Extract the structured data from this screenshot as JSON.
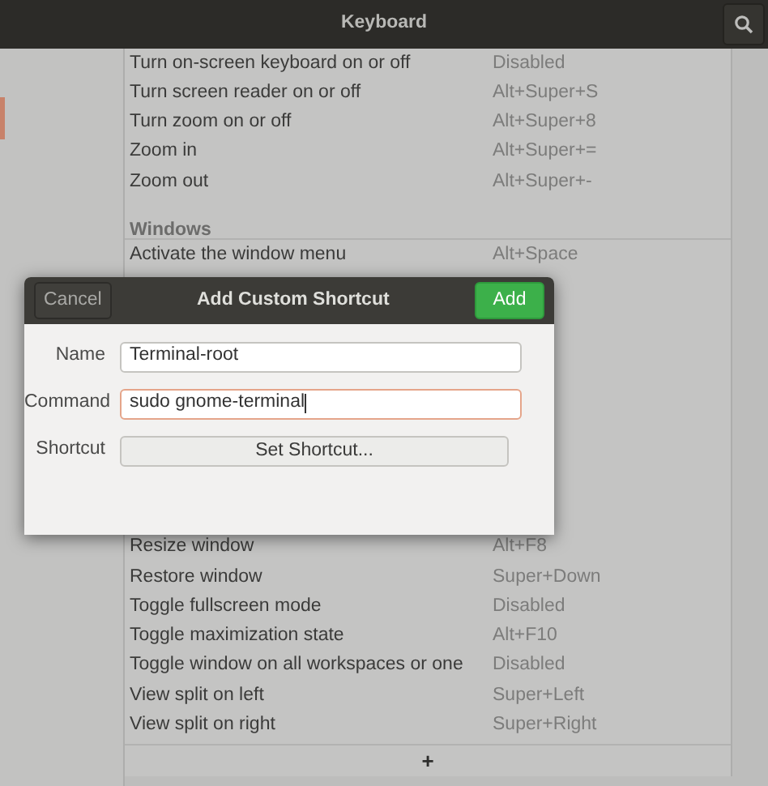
{
  "window": {
    "title": "Keyboard"
  },
  "sections": [
    {
      "rows": [
        {
          "name": "Turn on-screen keyboard on or off",
          "shortcut": "Disabled"
        },
        {
          "name": "Turn screen reader on or off",
          "shortcut": "Alt+Super+S"
        },
        {
          "name": "Turn zoom on or off",
          "shortcut": "Alt+Super+8"
        },
        {
          "name": "Zoom in",
          "shortcut": "Alt+Super+="
        },
        {
          "name": "Zoom out",
          "shortcut": "Alt+Super+-"
        }
      ]
    },
    {
      "title": "Windows",
      "rows": [
        {
          "name": "Activate the window menu",
          "shortcut": "Alt+Space"
        }
      ],
      "rows_after_dialog": [
        {
          "name": "Resize window",
          "shortcut": "Alt+F8"
        },
        {
          "name": "Restore window",
          "shortcut": "Super+Down"
        },
        {
          "name": "Toggle fullscreen mode",
          "shortcut": "Disabled"
        },
        {
          "name": "Toggle maximization state",
          "shortcut": "Alt+F10"
        },
        {
          "name": "Toggle window on all workspaces or one",
          "shortcut": "Disabled"
        },
        {
          "name": "View split on left",
          "shortcut": "Super+Left"
        },
        {
          "name": "View split on right",
          "shortcut": "Super+Right"
        }
      ]
    }
  ],
  "add_button": "+",
  "dialog": {
    "title": "Add Custom Shortcut",
    "cancel": "Cancel",
    "confirm": "Add",
    "fields": [
      {
        "label": "Name",
        "value": "Terminal-root",
        "focused": false
      },
      {
        "label": "Command",
        "value": "sudo gnome-terminal",
        "focused": true
      }
    ],
    "shortcut_label": "Shortcut",
    "shortcut_button": "Set Shortcut..."
  }
}
